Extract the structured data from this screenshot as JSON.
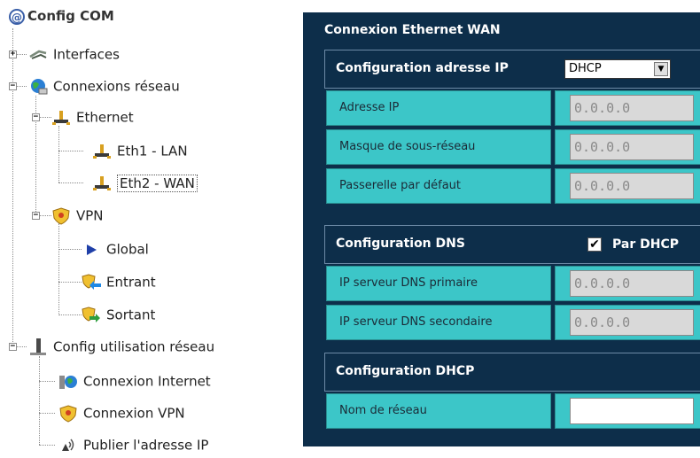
{
  "tree": {
    "root": "Config COM",
    "items": [
      {
        "label": "Interfaces",
        "icon": "network-cable-icon"
      },
      {
        "label": "Connexions réseau",
        "icon": "globe-network-icon"
      },
      {
        "label": "Ethernet",
        "icon": "ethernet-connector-icon"
      },
      {
        "label": "Eth1 - LAN",
        "icon": "ethernet-connector-icon"
      },
      {
        "label": "Eth2 - WAN",
        "icon": "ethernet-connector-icon",
        "selected": true
      },
      {
        "label": "VPN",
        "icon": "vpn-shield-icon"
      },
      {
        "label": "Global",
        "icon": "play-arrow-icon"
      },
      {
        "label": "Entrant",
        "icon": "vpn-incoming-icon"
      },
      {
        "label": "Sortant",
        "icon": "vpn-outgoing-icon"
      },
      {
        "label": "Config utilisation réseau",
        "icon": "tower-pc-icon"
      },
      {
        "label": "Connexion Internet",
        "icon": "internet-globe-icon"
      },
      {
        "label": "Connexion VPN",
        "icon": "vpn-shield-icon"
      },
      {
        "label": "Publier l'adresse IP",
        "icon": "broadcast-icon"
      }
    ]
  },
  "panel": {
    "title": "Connexion Ethernet WAN",
    "ip_section": {
      "title": "Configuration adresse IP",
      "mode_select": "DHCP",
      "fields": [
        {
          "label": "Adresse IP",
          "value": "0.0.0.0"
        },
        {
          "label": "Masque de sous-réseau",
          "value": "0.0.0.0"
        },
        {
          "label": "Passerelle par défaut",
          "value": "0.0.0.0"
        }
      ]
    },
    "dns_section": {
      "title": "Configuration DNS",
      "checkbox_label": "Par DHCP",
      "checked": true,
      "fields": [
        {
          "label": "IP serveur DNS primaire",
          "value": "0.0.0.0"
        },
        {
          "label": "IP serveur DNS secondaire",
          "value": "0.0.0.0"
        }
      ]
    },
    "dhcp_section": {
      "title": "Configuration DHCP",
      "fields": [
        {
          "label": "Nom de réseau",
          "value": ""
        }
      ]
    }
  },
  "colors": {
    "panel_bg": "#0d2e4a",
    "row_bg": "#3cc6c8"
  }
}
